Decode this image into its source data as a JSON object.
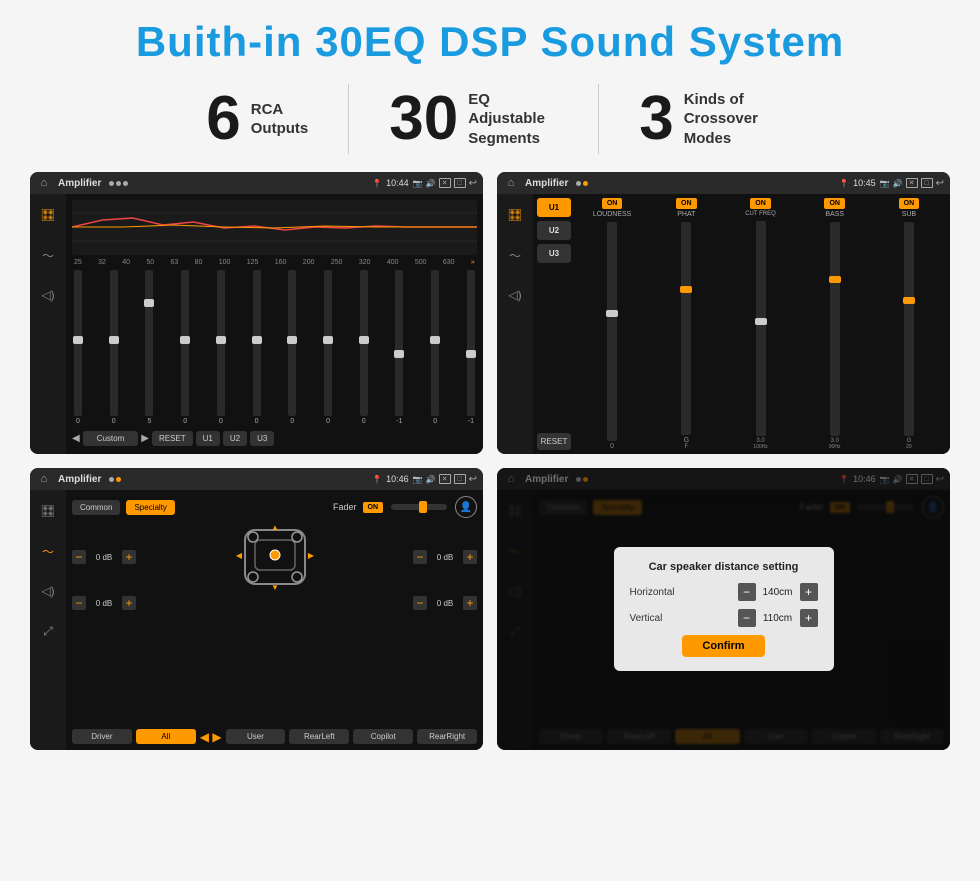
{
  "header": {
    "title": "Buith-in 30EQ DSP Sound System"
  },
  "stats": [
    {
      "number": "6",
      "label": "RCA\nOutputs"
    },
    {
      "number": "30",
      "label": "EQ Adjustable\nSegments"
    },
    {
      "number": "3",
      "label": "Kinds of\nCrossover Modes"
    }
  ],
  "screens": [
    {
      "id": "screen1",
      "app": "Amplifier",
      "time": "10:44",
      "desc": "30-band EQ screen"
    },
    {
      "id": "screen2",
      "app": "Amplifier",
      "time": "10:45",
      "desc": "Crossover modes screen"
    },
    {
      "id": "screen3",
      "app": "Amplifier",
      "time": "10:46",
      "desc": "Fader/Speaker screen"
    },
    {
      "id": "screen4",
      "app": "Amplifier",
      "time": "10:46",
      "desc": "Distance setting dialog"
    }
  ],
  "eq": {
    "bands": [
      "25",
      "32",
      "40",
      "50",
      "63",
      "80",
      "100",
      "125",
      "160",
      "200",
      "250",
      "320",
      "400",
      "500",
      "630"
    ],
    "values": [
      "0",
      "0",
      "0",
      "5",
      "0",
      "0",
      "0",
      "0",
      "0",
      "0",
      "-1",
      "0",
      "-1",
      "0",
      "0"
    ],
    "preset": "Custom",
    "buttons": [
      "RESET",
      "U1",
      "U2",
      "U3"
    ]
  },
  "crossover": {
    "presets": [
      "U1",
      "U2",
      "U3"
    ],
    "channels": [
      "LOUDNESS",
      "PHAT",
      "CUT FREQ",
      "BASS",
      "SUB"
    ],
    "toggles": [
      "ON",
      "ON",
      "ON",
      "ON",
      "ON"
    ]
  },
  "fader": {
    "tabs": [
      "Common",
      "Specialty"
    ],
    "fader_label": "Fader",
    "fader_on": "ON",
    "levels": [
      "0 dB",
      "0 dB",
      "0 dB",
      "0 dB"
    ],
    "footer_btns": [
      "Driver",
      "All",
      "User",
      "RearLeft",
      "Copilot",
      "RearRight"
    ]
  },
  "dialog": {
    "title": "Car speaker distance setting",
    "horizontal_label": "Horizontal",
    "horizontal_value": "140cm",
    "vertical_label": "Vertical",
    "vertical_value": "110cm",
    "confirm_label": "Confirm"
  }
}
